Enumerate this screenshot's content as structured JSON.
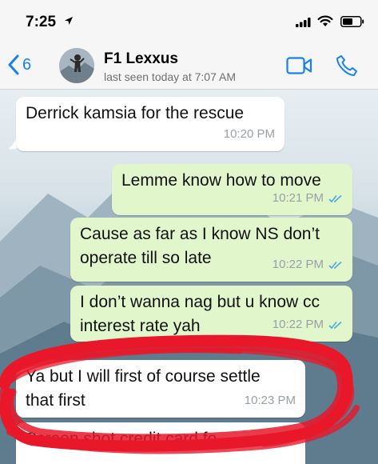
{
  "status_bar": {
    "time": "7:25",
    "icons": [
      "location-arrow-icon",
      "signal-icon",
      "wifi-icon",
      "battery-icon"
    ]
  },
  "header": {
    "back_count": "6",
    "contact_name": "F1 Lexxus",
    "last_seen": "last seen today at 7:07 AM",
    "actions": [
      "video-call-icon",
      "phone-icon"
    ],
    "accent": "#1b7ff0"
  },
  "messages": [
    {
      "dir": "in",
      "text": "Derrick kamsia for the rescue",
      "time": "10:20 PM"
    },
    {
      "dir": "out",
      "text": "Lemme know how to move",
      "time": "10:21 PM",
      "read": true
    },
    {
      "dir": "out",
      "text": "Cause as far as I know NS don’t\noperate till so late",
      "time": "10:22 PM",
      "read": true
    },
    {
      "dir": "out",
      "text": "I don’t wanna nag but u know cc\ninterest rate yah",
      "time": "10:22 PM",
      "read": true
    },
    {
      "dir": "in",
      "text": "Ya but I will first of course settle\nthat first",
      "time": "10:23 PM"
    },
    {
      "dir": "in",
      "text": "Screen shot credit card fo",
      "time": ""
    }
  ],
  "colors": {
    "incoming_bubble": "#ffffff",
    "outgoing_bubble": "#e1f7cb",
    "read_ticks": "#4fa9e4",
    "scribble": "#e8182a"
  }
}
